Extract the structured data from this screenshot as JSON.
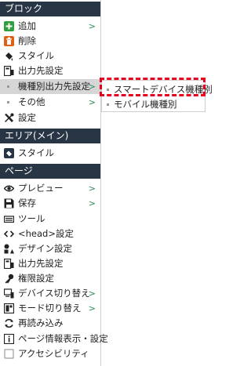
{
  "sections": {
    "block": "ブロック",
    "area": "エリア(メイン)",
    "page": "ページ"
  },
  "block_items": {
    "add": "追加",
    "delete": "削除",
    "style": "スタイル",
    "output_target": "出力先設定",
    "device_output": "機種別出力先設定",
    "other": "その他",
    "settings": "設定"
  },
  "area_items": {
    "style": "スタイル"
  },
  "page_items": {
    "preview": "プレビュー",
    "save": "保存",
    "tools": "ツール",
    "head_settings": "<head>設定",
    "design_settings": "デザイン設定",
    "output_target": "出力先設定",
    "permissions": "権限設定",
    "device_switch": "デバイス切り替え",
    "mode_switch": "モード切り替え",
    "reload": "再読み込み",
    "page_info": "ページ情報表示・設定",
    "accessibility": "アクセシビリティ"
  },
  "submenu": {
    "smart_device": "スマートデバイス機種別",
    "mobile": "モバイル機種別"
  },
  "arrow_glyph": ">",
  "colors": {
    "header_bg": "#283545",
    "arrow": "#2e8b57",
    "add_icon": "#2e9e3e",
    "delete_icon": "#e06010",
    "highlight": "#e8001c"
  }
}
